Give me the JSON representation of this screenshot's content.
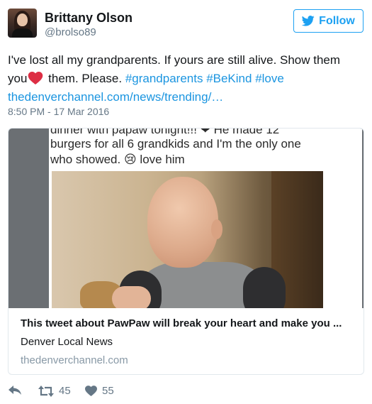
{
  "user": {
    "name": "Brittany Olson",
    "handle": "@brolso89",
    "avatar_icon": "profile-photo"
  },
  "follow_button": {
    "label": "Follow",
    "color": "#1da1f2",
    "icon": "bird-icon"
  },
  "tweet": {
    "text_part1": "I've lost all my grandparents. If yours are still alive. Show them you",
    "emoji": "red-heart",
    "text_part2": " them. Please. ",
    "hashtags": [
      "#grandparents",
      "#BeKind",
      "#love"
    ],
    "link": "thedenverchannel.com/news/trending/…",
    "timestamp": "8:50 PM - 17 Mar 2016"
  },
  "card": {
    "image_text_line0": "dinner with papaw tonight!!! ❤ He made 12",
    "image_text_line1": "burgers for all 6 grandkids and I'm the only one",
    "image_text_line2_a": "who showed. ",
    "image_text_emoji": "😢",
    "image_text_line2_b": " love him",
    "title": "This tweet about PawPaw will break your heart and make you ...",
    "source": "Denver Local News",
    "domain": "thedenverchannel.com"
  },
  "actions": {
    "reply_icon": "reply-icon",
    "retweet_icon": "retweet-icon",
    "retweet_count": "45",
    "like_icon": "heart-icon",
    "like_count": "55"
  },
  "colors": {
    "link": "#1b95e0",
    "meta_gray": "#657786",
    "border": "#e1e8ed",
    "heart_red": "#e0245e"
  }
}
